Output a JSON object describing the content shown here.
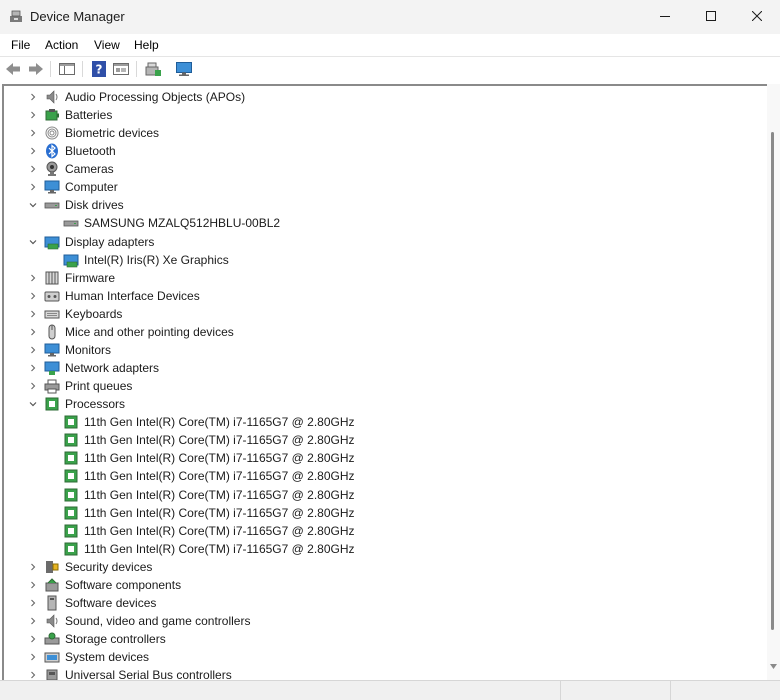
{
  "window": {
    "title": "Device Manager"
  },
  "menu": {
    "items": [
      "File",
      "Action",
      "View",
      "Help"
    ]
  },
  "tree": [
    {
      "label": "Audio Processing Objects (APOs)",
      "icon": "speaker-icon",
      "expanded": false,
      "level": 0
    },
    {
      "label": "Batteries",
      "icon": "battery-icon",
      "expanded": false,
      "level": 0
    },
    {
      "label": "Biometric devices",
      "icon": "fingerprint-icon",
      "expanded": false,
      "level": 0
    },
    {
      "label": "Bluetooth",
      "icon": "bluetooth-icon",
      "expanded": false,
      "level": 0
    },
    {
      "label": "Cameras",
      "icon": "camera-icon",
      "expanded": false,
      "level": 0
    },
    {
      "label": "Computer",
      "icon": "computer-icon",
      "expanded": false,
      "level": 0
    },
    {
      "label": "Disk drives",
      "icon": "disk-drive-icon",
      "expanded": true,
      "level": 0
    },
    {
      "label": "SAMSUNG MZALQ512HBLU-00BL2",
      "icon": "disk-drive-icon",
      "level": 1
    },
    {
      "label": "Display adapters",
      "icon": "display-adapter-icon",
      "expanded": true,
      "level": 0
    },
    {
      "label": "Intel(R) Iris(R) Xe Graphics",
      "icon": "display-adapter-icon",
      "level": 1
    },
    {
      "label": "Firmware",
      "icon": "firmware-icon",
      "expanded": false,
      "level": 0
    },
    {
      "label": "Human Interface Devices",
      "icon": "hid-icon",
      "expanded": false,
      "level": 0
    },
    {
      "label": "Keyboards",
      "icon": "keyboard-icon",
      "expanded": false,
      "level": 0
    },
    {
      "label": "Mice and other pointing devices",
      "icon": "mouse-icon",
      "expanded": false,
      "level": 0
    },
    {
      "label": "Monitors",
      "icon": "monitor-icon",
      "expanded": false,
      "level": 0
    },
    {
      "label": "Network adapters",
      "icon": "network-icon",
      "expanded": false,
      "level": 0
    },
    {
      "label": "Print queues",
      "icon": "printer-icon",
      "expanded": false,
      "level": 0
    },
    {
      "label": "Processors",
      "icon": "processor-icon",
      "expanded": true,
      "level": 0
    },
    {
      "label": "11th Gen Intel(R) Core(TM) i7-1165G7 @ 2.80GHz",
      "icon": "processor-icon",
      "level": 1
    },
    {
      "label": "11th Gen Intel(R) Core(TM) i7-1165G7 @ 2.80GHz",
      "icon": "processor-icon",
      "level": 1
    },
    {
      "label": "11th Gen Intel(R) Core(TM) i7-1165G7 @ 2.80GHz",
      "icon": "processor-icon",
      "level": 1
    },
    {
      "label": "11th Gen Intel(R) Core(TM) i7-1165G7 @ 2.80GHz",
      "icon": "processor-icon",
      "level": 1
    },
    {
      "label": "11th Gen Intel(R) Core(TM) i7-1165G7 @ 2.80GHz",
      "icon": "processor-icon",
      "level": 1
    },
    {
      "label": "11th Gen Intel(R) Core(TM) i7-1165G7 @ 2.80GHz",
      "icon": "processor-icon",
      "level": 1
    },
    {
      "label": "11th Gen Intel(R) Core(TM) i7-1165G7 @ 2.80GHz",
      "icon": "processor-icon",
      "level": 1
    },
    {
      "label": "11th Gen Intel(R) Core(TM) i7-1165G7 @ 2.80GHz",
      "icon": "processor-icon",
      "level": 1
    },
    {
      "label": "Security devices",
      "icon": "security-key-icon",
      "expanded": false,
      "level": 0
    },
    {
      "label": "Software components",
      "icon": "software-component-icon",
      "expanded": false,
      "level": 0
    },
    {
      "label": "Software devices",
      "icon": "software-device-icon",
      "expanded": false,
      "level": 0
    },
    {
      "label": "Sound, video and game controllers",
      "icon": "speaker-icon",
      "expanded": false,
      "level": 0
    },
    {
      "label": "Storage controllers",
      "icon": "storage-controller-icon",
      "expanded": false,
      "level": 0
    },
    {
      "label": "System devices",
      "icon": "system-device-icon",
      "expanded": false,
      "level": 0
    },
    {
      "label": "Universal Serial Bus controllers",
      "icon": "usb-icon",
      "expanded": false,
      "level": 0
    }
  ]
}
